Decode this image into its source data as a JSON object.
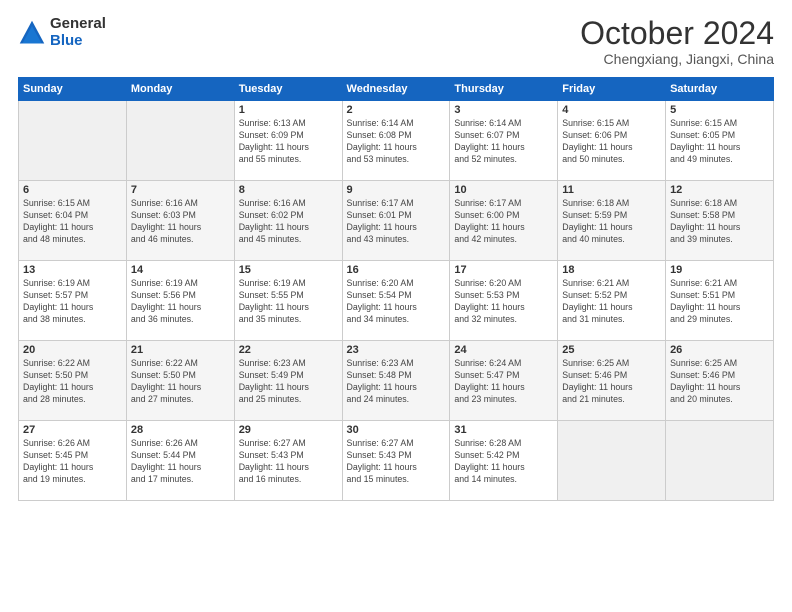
{
  "logo": {
    "general": "General",
    "blue": "Blue"
  },
  "title": "October 2024",
  "location": "Chengxiang, Jiangxi, China",
  "days_of_week": [
    "Sunday",
    "Monday",
    "Tuesday",
    "Wednesday",
    "Thursday",
    "Friday",
    "Saturday"
  ],
  "weeks": [
    [
      {
        "day": "",
        "empty": true
      },
      {
        "day": "",
        "empty": true
      },
      {
        "day": "1",
        "sunrise": "6:13 AM",
        "sunset": "6:09 PM",
        "daylight": "11 hours and 55 minutes."
      },
      {
        "day": "2",
        "sunrise": "6:14 AM",
        "sunset": "6:08 PM",
        "daylight": "11 hours and 53 minutes."
      },
      {
        "day": "3",
        "sunrise": "6:14 AM",
        "sunset": "6:07 PM",
        "daylight": "11 hours and 52 minutes."
      },
      {
        "day": "4",
        "sunrise": "6:15 AM",
        "sunset": "6:06 PM",
        "daylight": "11 hours and 50 minutes."
      },
      {
        "day": "5",
        "sunrise": "6:15 AM",
        "sunset": "6:05 PM",
        "daylight": "11 hours and 49 minutes."
      }
    ],
    [
      {
        "day": "6",
        "sunrise": "6:15 AM",
        "sunset": "6:04 PM",
        "daylight": "11 hours and 48 minutes."
      },
      {
        "day": "7",
        "sunrise": "6:16 AM",
        "sunset": "6:03 PM",
        "daylight": "11 hours and 46 minutes."
      },
      {
        "day": "8",
        "sunrise": "6:16 AM",
        "sunset": "6:02 PM",
        "daylight": "11 hours and 45 minutes."
      },
      {
        "day": "9",
        "sunrise": "6:17 AM",
        "sunset": "6:01 PM",
        "daylight": "11 hours and 43 minutes."
      },
      {
        "day": "10",
        "sunrise": "6:17 AM",
        "sunset": "6:00 PM",
        "daylight": "11 hours and 42 minutes."
      },
      {
        "day": "11",
        "sunrise": "6:18 AM",
        "sunset": "5:59 PM",
        "daylight": "11 hours and 40 minutes."
      },
      {
        "day": "12",
        "sunrise": "6:18 AM",
        "sunset": "5:58 PM",
        "daylight": "11 hours and 39 minutes."
      }
    ],
    [
      {
        "day": "13",
        "sunrise": "6:19 AM",
        "sunset": "5:57 PM",
        "daylight": "11 hours and 38 minutes."
      },
      {
        "day": "14",
        "sunrise": "6:19 AM",
        "sunset": "5:56 PM",
        "daylight": "11 hours and 36 minutes."
      },
      {
        "day": "15",
        "sunrise": "6:19 AM",
        "sunset": "5:55 PM",
        "daylight": "11 hours and 35 minutes."
      },
      {
        "day": "16",
        "sunrise": "6:20 AM",
        "sunset": "5:54 PM",
        "daylight": "11 hours and 34 minutes."
      },
      {
        "day": "17",
        "sunrise": "6:20 AM",
        "sunset": "5:53 PM",
        "daylight": "11 hours and 32 minutes."
      },
      {
        "day": "18",
        "sunrise": "6:21 AM",
        "sunset": "5:52 PM",
        "daylight": "11 hours and 31 minutes."
      },
      {
        "day": "19",
        "sunrise": "6:21 AM",
        "sunset": "5:51 PM",
        "daylight": "11 hours and 29 minutes."
      }
    ],
    [
      {
        "day": "20",
        "sunrise": "6:22 AM",
        "sunset": "5:50 PM",
        "daylight": "11 hours and 28 minutes."
      },
      {
        "day": "21",
        "sunrise": "6:22 AM",
        "sunset": "5:50 PM",
        "daylight": "11 hours and 27 minutes."
      },
      {
        "day": "22",
        "sunrise": "6:23 AM",
        "sunset": "5:49 PM",
        "daylight": "11 hours and 25 minutes."
      },
      {
        "day": "23",
        "sunrise": "6:23 AM",
        "sunset": "5:48 PM",
        "daylight": "11 hours and 24 minutes."
      },
      {
        "day": "24",
        "sunrise": "6:24 AM",
        "sunset": "5:47 PM",
        "daylight": "11 hours and 23 minutes."
      },
      {
        "day": "25",
        "sunrise": "6:25 AM",
        "sunset": "5:46 PM",
        "daylight": "11 hours and 21 minutes."
      },
      {
        "day": "26",
        "sunrise": "6:25 AM",
        "sunset": "5:46 PM",
        "daylight": "11 hours and 20 minutes."
      }
    ],
    [
      {
        "day": "27",
        "sunrise": "6:26 AM",
        "sunset": "5:45 PM",
        "daylight": "11 hours and 19 minutes."
      },
      {
        "day": "28",
        "sunrise": "6:26 AM",
        "sunset": "5:44 PM",
        "daylight": "11 hours and 17 minutes."
      },
      {
        "day": "29",
        "sunrise": "6:27 AM",
        "sunset": "5:43 PM",
        "daylight": "11 hours and 16 minutes."
      },
      {
        "day": "30",
        "sunrise": "6:27 AM",
        "sunset": "5:43 PM",
        "daylight": "11 hours and 15 minutes."
      },
      {
        "day": "31",
        "sunrise": "6:28 AM",
        "sunset": "5:42 PM",
        "daylight": "11 hours and 14 minutes."
      },
      {
        "day": "",
        "empty": true
      },
      {
        "day": "",
        "empty": true
      }
    ]
  ],
  "labels": {
    "sunrise": "Sunrise:",
    "sunset": "Sunset:",
    "daylight": "Daylight:"
  }
}
